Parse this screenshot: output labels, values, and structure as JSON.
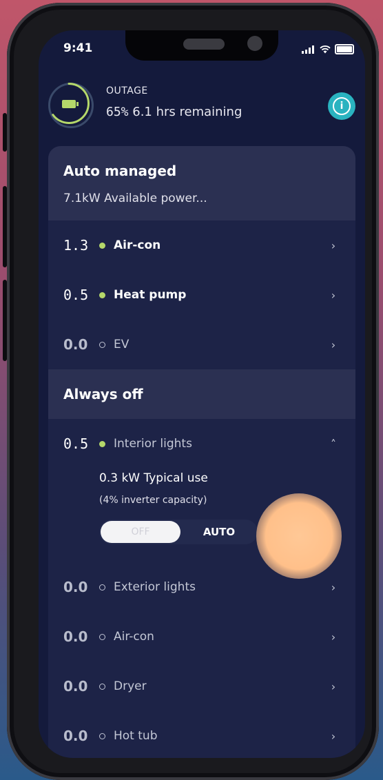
{
  "status_bar": {
    "time": "9:41"
  },
  "outage": {
    "label": "OUTAGE",
    "battery_percent": "65%",
    "remaining": "6.1 hrs remaining",
    "battery_level": 0.65
  },
  "auto_managed": {
    "title": "Auto managed",
    "subtitle": "7.1kW Available power...",
    "items": [
      {
        "value": "1.3",
        "name": "Air-con",
        "active": true
      },
      {
        "value": "0.5",
        "name": "Heat pump",
        "active": true
      },
      {
        "value": "0.0",
        "name": "EV",
        "active": false
      }
    ]
  },
  "always_off": {
    "title": "Always off",
    "expanded_item": {
      "value": "0.5",
      "name": "Interior lights",
      "typical_use": "0.3 kW Typical use",
      "capacity": "(4% inverter capacity)",
      "toggle_off": "OFF",
      "toggle_auto": "AUTO"
    },
    "items": [
      {
        "value": "0.0",
        "name": "Exterior lights"
      },
      {
        "value": "0.0",
        "name": "Air-con"
      },
      {
        "value": "0.0",
        "name": "Dryer"
      },
      {
        "value": "0.0",
        "name": "Hot tub"
      }
    ]
  },
  "icons": {
    "chevron_right": "›",
    "chevron_up": "˄",
    "info": "i"
  },
  "colors": {
    "accent_green": "#b5d86a",
    "info_teal": "#2ab3c0",
    "background": "#141a3c"
  }
}
